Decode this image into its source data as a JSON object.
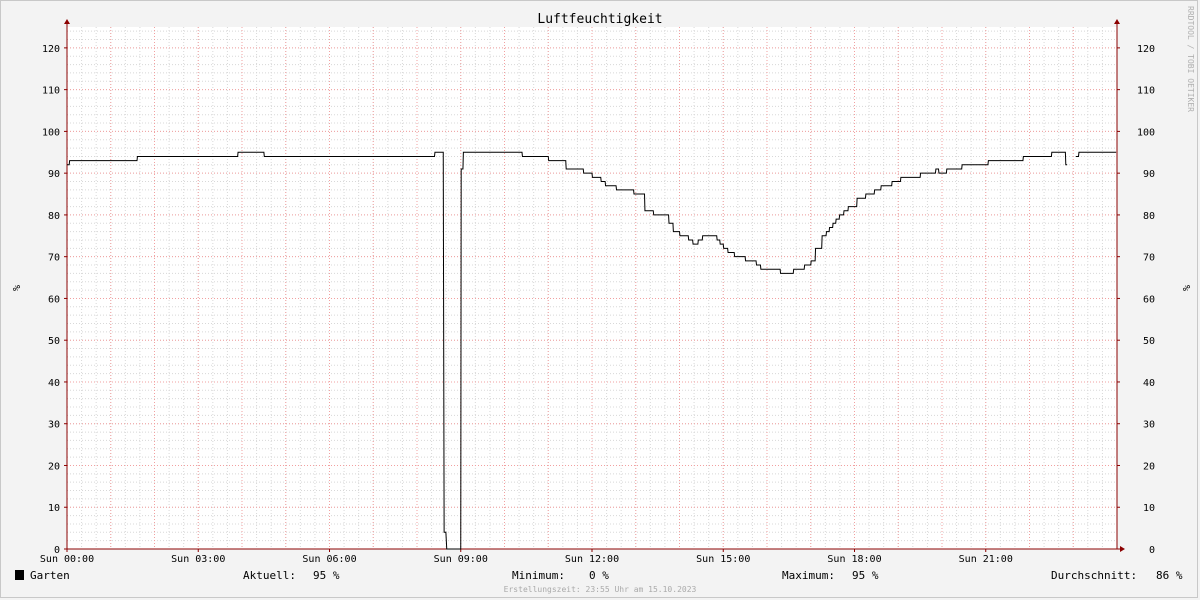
{
  "chart_data": {
    "type": "line",
    "title": "Luftfeuchtigkeit",
    "ylabel": "%",
    "ylim": [
      0,
      125
    ],
    "y_ticks": [
      0,
      10,
      20,
      30,
      40,
      50,
      60,
      70,
      80,
      90,
      100,
      110,
      120
    ],
    "xlim": [
      0,
      24
    ],
    "x_ticks": [
      {
        "hour": 0,
        "label": "Sun 00:00"
      },
      {
        "hour": 3,
        "label": "Sun 03:00"
      },
      {
        "hour": 6,
        "label": "Sun 06:00"
      },
      {
        "hour": 9,
        "label": "Sun 09:00"
      },
      {
        "hour": 12,
        "label": "Sun 12:00"
      },
      {
        "hour": 15,
        "label": "Sun 15:00"
      },
      {
        "hour": 18,
        "label": "Sun 18:00"
      },
      {
        "hour": 21,
        "label": "Sun 21:00"
      }
    ],
    "grid": true,
    "series": [
      {
        "name": "Garten",
        "color": "#000000",
        "points": [
          [
            0.0,
            92
          ],
          [
            0.05,
            92
          ],
          [
            0.06,
            93
          ],
          [
            1.6,
            93
          ],
          [
            1.61,
            94
          ],
          [
            3.9,
            94
          ],
          [
            3.91,
            95
          ],
          [
            4.5,
            95
          ],
          [
            4.51,
            94
          ],
          [
            8.4,
            94
          ],
          [
            8.41,
            95
          ],
          [
            8.6,
            95
          ],
          [
            8.62,
            4
          ],
          [
            8.66,
            4
          ],
          [
            8.68,
            0
          ],
          [
            9.0,
            0
          ],
          [
            9.01,
            91
          ],
          [
            9.05,
            91
          ],
          [
            9.06,
            95
          ],
          [
            10.4,
            95
          ],
          [
            10.41,
            94
          ],
          [
            11.0,
            94
          ],
          [
            11.01,
            93
          ],
          [
            11.4,
            93
          ],
          [
            11.41,
            91
          ],
          [
            11.8,
            91
          ],
          [
            11.81,
            90
          ],
          [
            12.0,
            90
          ],
          [
            12.01,
            89
          ],
          [
            12.2,
            89
          ],
          [
            12.21,
            88
          ],
          [
            12.3,
            88
          ],
          [
            12.31,
            87
          ],
          [
            12.55,
            87
          ],
          [
            12.56,
            86
          ],
          [
            12.95,
            86
          ],
          [
            12.96,
            85
          ],
          [
            13.2,
            85
          ],
          [
            13.21,
            81
          ],
          [
            13.4,
            81
          ],
          [
            13.41,
            80
          ],
          [
            13.75,
            80
          ],
          [
            13.76,
            78
          ],
          [
            13.85,
            78
          ],
          [
            13.86,
            76
          ],
          [
            14.0,
            76
          ],
          [
            14.01,
            75
          ],
          [
            14.2,
            75
          ],
          [
            14.21,
            74
          ],
          [
            14.3,
            74
          ],
          [
            14.31,
            73
          ],
          [
            14.42,
            73
          ],
          [
            14.43,
            74
          ],
          [
            14.52,
            74
          ],
          [
            14.53,
            75
          ],
          [
            14.85,
            75
          ],
          [
            14.86,
            74
          ],
          [
            14.92,
            74
          ],
          [
            14.93,
            73
          ],
          [
            15.0,
            73
          ],
          [
            15.01,
            72
          ],
          [
            15.1,
            72
          ],
          [
            15.11,
            71
          ],
          [
            15.25,
            71
          ],
          [
            15.26,
            70
          ],
          [
            15.5,
            70
          ],
          [
            15.51,
            69
          ],
          [
            15.75,
            69
          ],
          [
            15.76,
            68
          ],
          [
            15.85,
            68
          ],
          [
            15.86,
            67
          ],
          [
            16.3,
            67
          ],
          [
            16.31,
            66
          ],
          [
            16.6,
            66
          ],
          [
            16.61,
            67
          ],
          [
            16.85,
            67
          ],
          [
            16.86,
            68
          ],
          [
            17.0,
            68
          ],
          [
            17.01,
            69
          ],
          [
            17.1,
            69
          ],
          [
            17.11,
            72
          ],
          [
            17.25,
            72
          ],
          [
            17.26,
            75
          ],
          [
            17.35,
            75
          ],
          [
            17.36,
            76
          ],
          [
            17.42,
            76
          ],
          [
            17.43,
            77
          ],
          [
            17.5,
            77
          ],
          [
            17.51,
            78
          ],
          [
            17.57,
            78
          ],
          [
            17.58,
            79
          ],
          [
            17.65,
            79
          ],
          [
            17.66,
            80
          ],
          [
            17.75,
            80
          ],
          [
            17.76,
            81
          ],
          [
            17.85,
            81
          ],
          [
            17.86,
            82
          ],
          [
            18.05,
            82
          ],
          [
            18.06,
            84
          ],
          [
            18.25,
            84
          ],
          [
            18.26,
            85
          ],
          [
            18.45,
            85
          ],
          [
            18.46,
            86
          ],
          [
            18.6,
            86
          ],
          [
            18.61,
            87
          ],
          [
            18.85,
            87
          ],
          [
            18.86,
            88
          ],
          [
            19.05,
            88
          ],
          [
            19.06,
            89
          ],
          [
            19.5,
            89
          ],
          [
            19.51,
            90
          ],
          [
            19.85,
            90
          ],
          [
            19.86,
            91
          ],
          [
            19.92,
            91
          ],
          [
            19.93,
            90
          ],
          [
            20.1,
            90
          ],
          [
            20.11,
            91
          ],
          [
            20.45,
            91
          ],
          [
            20.46,
            92
          ],
          [
            21.05,
            92
          ],
          [
            21.06,
            93
          ],
          [
            21.85,
            93
          ],
          [
            21.86,
            94
          ],
          [
            22.5,
            94
          ],
          [
            22.51,
            95
          ],
          [
            22.82,
            95
          ],
          [
            22.83,
            92
          ],
          [
            22.86,
            92
          ],
          [
            22.88,
            null
          ],
          [
            23.05,
            null
          ],
          [
            23.06,
            94
          ],
          [
            23.12,
            94
          ],
          [
            23.13,
            95
          ],
          [
            23.98,
            95
          ]
        ]
      }
    ]
  },
  "legend": {
    "series_name": "Garten",
    "swatch_color": "#000000",
    "stats": [
      {
        "label": "Aktuell:",
        "value": "95 %"
      },
      {
        "label": "Minimum:",
        "value": "0 %"
      },
      {
        "label": "Maximum:",
        "value": "95 %"
      },
      {
        "label": "Durchschnitt:",
        "value": "86 %"
      }
    ]
  },
  "footer": "Erstellungszeit: 23:55 Uhr am 15.10.2023",
  "watermark": "RRDTOOL / TOBI OETIKER",
  "colors": {
    "background": "#f3f3f3",
    "canvas": "#ffffff",
    "minor_grid": "#d8d8d8",
    "major_grid": "#f2a0a0",
    "axis": "#8b0000",
    "line": "#000000"
  }
}
